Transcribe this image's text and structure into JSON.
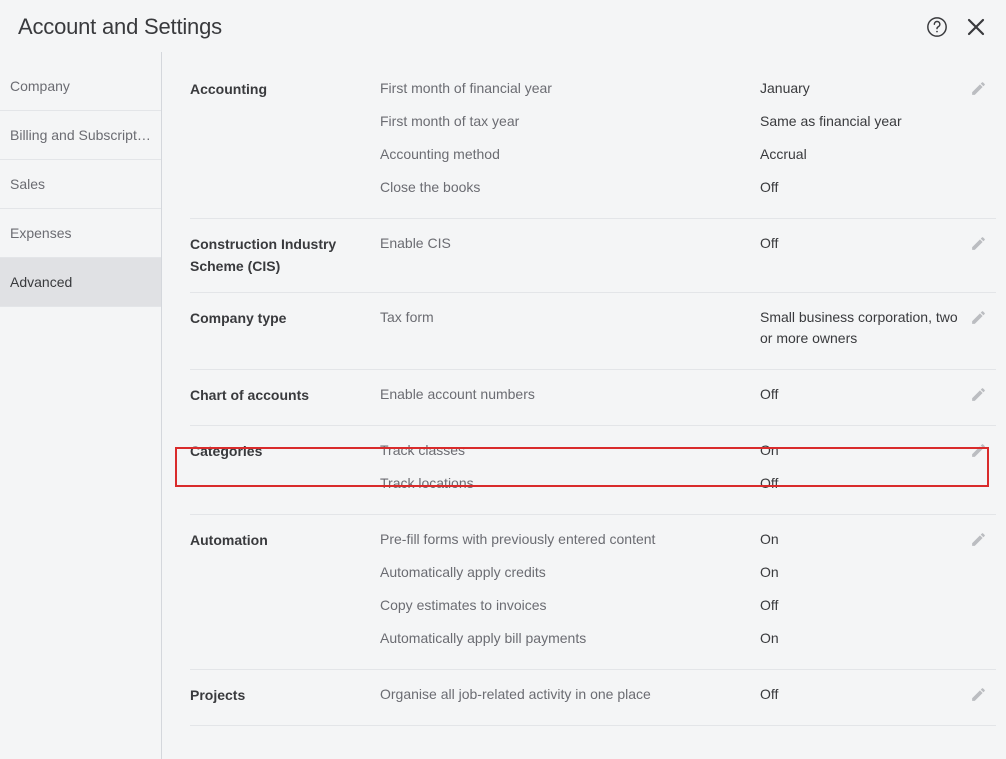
{
  "header": {
    "title": "Account and Settings"
  },
  "sidebar": {
    "items": [
      {
        "label": "Company",
        "active": false
      },
      {
        "label": "Billing and Subscription",
        "active": false
      },
      {
        "label": "Sales",
        "active": false
      },
      {
        "label": "Expenses",
        "active": false
      },
      {
        "label": "Advanced",
        "active": true
      }
    ]
  },
  "sections": [
    {
      "title": "Accounting",
      "rows": [
        {
          "label": "First month of financial year",
          "value": "January"
        },
        {
          "label": "First month of tax year",
          "value": "Same as financial year"
        },
        {
          "label": "Accounting method",
          "value": "Accrual"
        },
        {
          "label": "Close the books",
          "value": "Off"
        }
      ]
    },
    {
      "title": "Construction Industry Scheme (CIS)",
      "rows": [
        {
          "label": "Enable CIS",
          "value": "Off"
        }
      ]
    },
    {
      "title": "Company type",
      "rows": [
        {
          "label": "Tax form",
          "value": "Small business corporation, two or more owners"
        }
      ]
    },
    {
      "title": "Chart of accounts",
      "rows": [
        {
          "label": "Enable account numbers",
          "value": "Off"
        }
      ]
    },
    {
      "title": "Categories",
      "rows": [
        {
          "label": "Track classes",
          "value": "On"
        },
        {
          "label": "Track locations",
          "value": "Off"
        }
      ]
    },
    {
      "title": "Automation",
      "rows": [
        {
          "label": "Pre-fill forms with previously entered content",
          "value": "On"
        },
        {
          "label": "Automatically apply credits",
          "value": "On"
        },
        {
          "label": "Copy estimates to invoices",
          "value": "Off"
        },
        {
          "label": "Automatically apply bill payments",
          "value": "On"
        }
      ]
    },
    {
      "title": "Projects",
      "rows": [
        {
          "label": "Organise all job-related activity in one place",
          "value": "Off"
        }
      ]
    }
  ]
}
